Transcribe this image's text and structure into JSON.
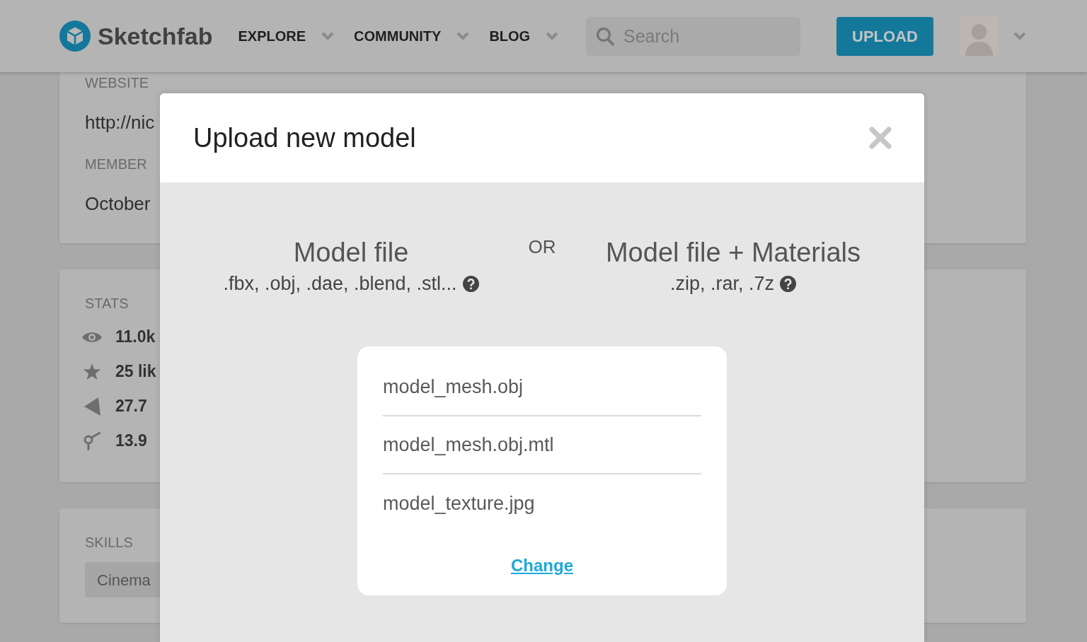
{
  "header": {
    "logo": "Sketchfab",
    "nav": [
      {
        "label": "EXPLORE"
      },
      {
        "label": "COMMUNITY"
      },
      {
        "label": "BLOG"
      }
    ],
    "search": {
      "placeholder": "Search"
    },
    "upload_button": "UPLOAD"
  },
  "profile": {
    "about_card": {
      "fields": [
        {
          "label": "WEBSITE",
          "value": "http://nic"
        },
        {
          "label": "MEMBER",
          "value": "October"
        }
      ]
    },
    "stats_card": {
      "title": "STATS",
      "stats": [
        {
          "kind": "views",
          "value": "11.0k"
        },
        {
          "kind": "likes",
          "value": "25 lik"
        },
        {
          "kind": "triangles",
          "value": "27.7"
        },
        {
          "kind": "vertices",
          "value": "13.9"
        }
      ]
    },
    "skills_card": {
      "title": "SKILLS",
      "skills": [
        "Cinema"
      ]
    }
  },
  "dialog": {
    "title": "Upload new model",
    "options": [
      {
        "title": "Model file",
        "formats": ".fbx, .obj, .dae, .blend, .stl..."
      },
      {
        "title": "Model file + Materials",
        "formats": ".zip, .rar, .7z"
      }
    ],
    "separator": "OR",
    "files": [
      "model_mesh.obj",
      "model_mesh.obj.mtl",
      "model_texture.jpg"
    ],
    "change_link": "Change"
  }
}
